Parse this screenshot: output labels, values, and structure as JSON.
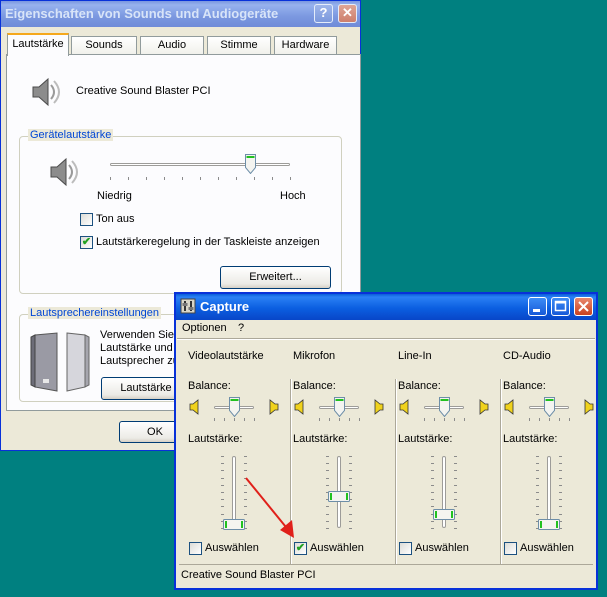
{
  "properties_window": {
    "title": "Eigenschaften von Sounds und Audiogeräte",
    "help_glyph": "?",
    "close_glyph": "✕",
    "tabs": [
      {
        "label": "Lautstärke",
        "active": true
      },
      {
        "label": "Sounds",
        "active": false
      },
      {
        "label": "Audio",
        "active": false
      },
      {
        "label": "Stimme",
        "active": false
      },
      {
        "label": "Hardware",
        "active": false
      }
    ],
    "device_name": "Creative Sound Blaster PCI",
    "device_volume": {
      "legend": "Gerätelautstärke",
      "low_label": "Niedrig",
      "high_label": "Hoch",
      "level": 0.78,
      "mute_label": "Ton aus",
      "mute_checked": false,
      "taskbar_label": "Lautstärkeregelung in der Taskleiste anzeigen",
      "taskbar_checked": true,
      "advanced_button": "Erweitert..."
    },
    "speaker_settings": {
      "legend": "Lautsprechereinstellungen",
      "text_line1": "Verwenden Sie",
      "text_line2": "Lautstärke und",
      "text_line3": "Lautsprecher zu",
      "button_label": "Lautstärke"
    },
    "ok_button": "OK"
  },
  "capture_window": {
    "title": "Capture",
    "menu": [
      "Optionen",
      "?"
    ],
    "balance_label": "Balance:",
    "volume_label": "Lautstärke:",
    "select_label": "Auswählen",
    "channels": [
      {
        "name": "Videolautstärke",
        "balance": 0.5,
        "volume": 0.05,
        "selected": false
      },
      {
        "name": "Mikrofon",
        "balance": 0.5,
        "volume": 0.45,
        "selected": true
      },
      {
        "name": "Line-In",
        "balance": 0.5,
        "volume": 0.2,
        "selected": false
      },
      {
        "name": "CD-Audio",
        "balance": 0.5,
        "volume": 0.05,
        "selected": false
      }
    ],
    "status_text": "Creative Sound Blaster PCI"
  },
  "colors": {
    "desktop": "#008080",
    "titlebar": "#0a5fd8",
    "window_face": "#ece9d8",
    "group_legend": "#0046d5",
    "arrow": "#e0201a",
    "check": "#21a121"
  }
}
